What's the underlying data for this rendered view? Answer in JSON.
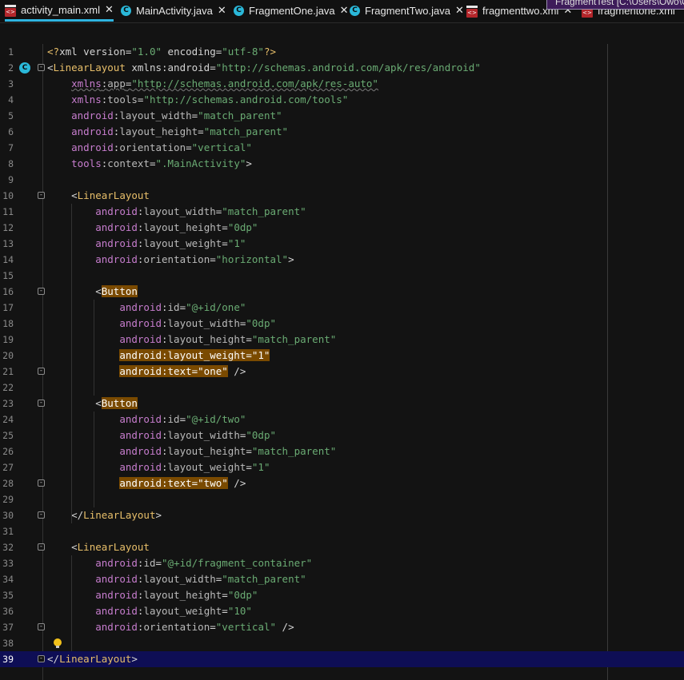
{
  "tabs": [
    {
      "label": "activity_main.xml",
      "icon": "xml-file-icon",
      "active": true,
      "closable": true
    },
    {
      "label": "MainActivity.java",
      "icon": "java-class-icon",
      "active": false,
      "closable": true
    },
    {
      "label": "FragmentOne.java",
      "icon": "java-class-icon",
      "active": false,
      "closable": true
    },
    {
      "label": "FragmentTwo.java",
      "icon": "java-class-icon",
      "active": false,
      "closable": true
    },
    {
      "label": "fragmenttwo.xml",
      "icon": "xml-file-icon",
      "active": false,
      "closable": true
    },
    {
      "label": "fragmentone.xml",
      "icon": "xml-file-icon",
      "active": false,
      "closable": false
    }
  ],
  "tooltip_text": "FragmentTest [C:\\Users\\Owo\\OBE\\",
  "editor": {
    "current_line": 39,
    "lines": [
      {
        "n": "1",
        "text": "<?xml version=\"1.0\" encoding=\"utf-8\"?>"
      },
      {
        "n": "2",
        "text": "<LinearLayout xmlns:android=\"http://schemas.android.com/apk/res/android\""
      },
      {
        "n": "3",
        "text": "    xmlns:app=\"http://schemas.android.com/apk/res-auto\""
      },
      {
        "n": "4",
        "text": "    xmlns:tools=\"http://schemas.android.com/tools\""
      },
      {
        "n": "5",
        "text": "    android:layout_width=\"match_parent\""
      },
      {
        "n": "6",
        "text": "    android:layout_height=\"match_parent\""
      },
      {
        "n": "7",
        "text": "    android:orientation=\"vertical\""
      },
      {
        "n": "8",
        "text": "    tools:context=\".MainActivity\">"
      },
      {
        "n": "9",
        "text": ""
      },
      {
        "n": "10",
        "text": "    <LinearLayout"
      },
      {
        "n": "11",
        "text": "        android:layout_width=\"match_parent\""
      },
      {
        "n": "12",
        "text": "        android:layout_height=\"0dp\""
      },
      {
        "n": "13",
        "text": "        android:layout_weight=\"1\""
      },
      {
        "n": "14",
        "text": "        android:orientation=\"horizontal\">"
      },
      {
        "n": "15",
        "text": ""
      },
      {
        "n": "16",
        "text": "        <Button"
      },
      {
        "n": "17",
        "text": "            android:id=\"@+id/one\""
      },
      {
        "n": "18",
        "text": "            android:layout_width=\"0dp\""
      },
      {
        "n": "19",
        "text": "            android:layout_height=\"match_parent\""
      },
      {
        "n": "20",
        "text": "            android:layout_weight=\"1\""
      },
      {
        "n": "21",
        "text": "            android:text=\"one\" />"
      },
      {
        "n": "22",
        "text": ""
      },
      {
        "n": "23",
        "text": "        <Button"
      },
      {
        "n": "24",
        "text": "            android:id=\"@+id/two\""
      },
      {
        "n": "25",
        "text": "            android:layout_width=\"0dp\""
      },
      {
        "n": "26",
        "text": "            android:layout_height=\"match_parent\""
      },
      {
        "n": "27",
        "text": "            android:layout_weight=\"1\""
      },
      {
        "n": "28",
        "text": "            android:text=\"two\" />"
      },
      {
        "n": "29",
        "text": ""
      },
      {
        "n": "30",
        "text": "    </LinearLayout>"
      },
      {
        "n": "31",
        "text": ""
      },
      {
        "n": "32",
        "text": "    <LinearLayout"
      },
      {
        "n": "33",
        "text": "        android:id=\"@+id/fragment_container\""
      },
      {
        "n": "34",
        "text": "        android:layout_width=\"match_parent\""
      },
      {
        "n": "35",
        "text": "        android:layout_height=\"0dp\""
      },
      {
        "n": "36",
        "text": "        android:layout_weight=\"10\""
      },
      {
        "n": "37",
        "text": "        android:orientation=\"vertical\" />"
      },
      {
        "n": "38",
        "text": ""
      },
      {
        "n": "39",
        "text": "</LinearLayout>"
      }
    ]
  },
  "colors": {
    "background": "#131313",
    "tab_accent": "#2fb4e0",
    "current_line": "#0e0e55",
    "tag": "#e8bf6a",
    "namespace": "#c77dce",
    "value": "#6aab73",
    "highlight": "#7a4a00"
  }
}
